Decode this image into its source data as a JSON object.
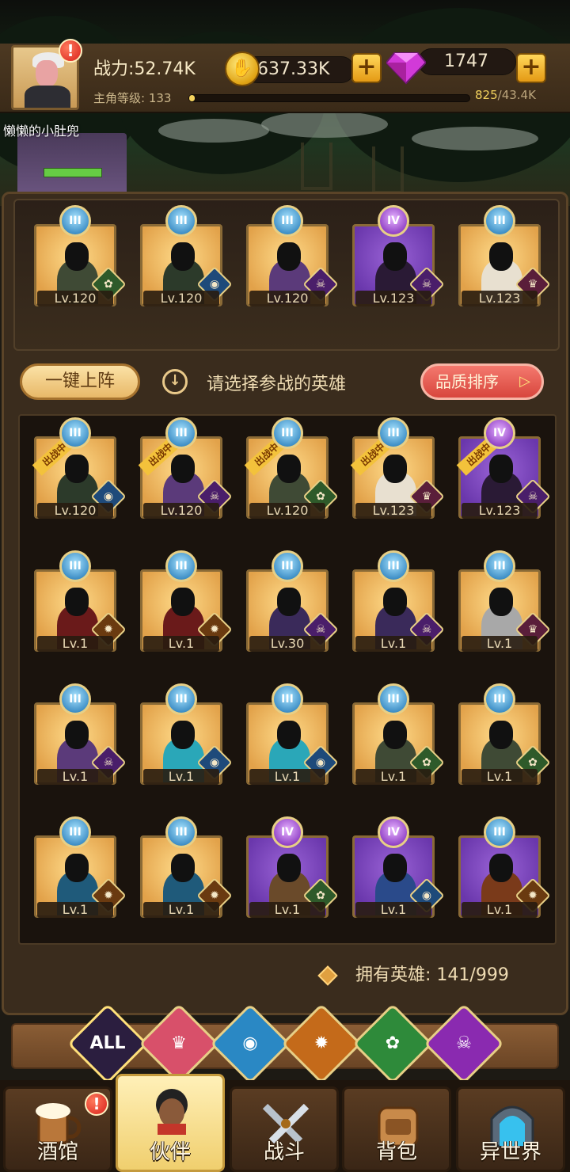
{
  "header": {
    "power_label": "战力:52.74K",
    "gold": "637.33K",
    "gems": "1747",
    "level_label": "主角等级:",
    "level": "133",
    "xp_current": "825",
    "xp_max": "/43.4K",
    "xp_progress": 0.019,
    "player_name": "懒懒的小肚兜",
    "alert_symbol": "!",
    "plus_symbol": "+"
  },
  "team": [
    {
      "rank": "III",
      "level": "Lv.120",
      "bg": "gold",
      "skin": "#3f4a35",
      "type": "elf"
    },
    {
      "rank": "III",
      "level": "Lv.120",
      "bg": "gold",
      "skin": "#2c3a2a",
      "type": "fish"
    },
    {
      "rank": "III",
      "level": "Lv.120",
      "bg": "gold",
      "skin": "#5b3a7a",
      "type": "demon"
    },
    {
      "rank": "IV",
      "level": "Lv.123",
      "bg": "purple",
      "skin": "#2a1a35",
      "type": "demon"
    },
    {
      "rank": "III",
      "level": "Lv.123",
      "bg": "gold",
      "skin": "#e8e0d0",
      "type": "knight"
    }
  ],
  "actions": {
    "oneclick_label": "一键上阵",
    "hint": "请选择参战的英雄",
    "sort_label": "品质排序",
    "down_symbol": "↓",
    "sort_arrow": "▷"
  },
  "deployed_ribbon": "出战中",
  "heroes": [
    {
      "rank": "III",
      "level": "Lv.120",
      "bg": "gold",
      "skin": "#2c3a2a",
      "type": "fish",
      "deployed": true
    },
    {
      "rank": "III",
      "level": "Lv.120",
      "bg": "gold",
      "skin": "#5b3a7a",
      "type": "demon",
      "deployed": true
    },
    {
      "rank": "III",
      "level": "Lv.120",
      "bg": "gold",
      "skin": "#3f4a35",
      "type": "elf",
      "deployed": true
    },
    {
      "rank": "III",
      "level": "Lv.123",
      "bg": "gold",
      "skin": "#e8e0d0",
      "type": "knight",
      "deployed": true
    },
    {
      "rank": "IV",
      "level": "Lv.123",
      "bg": "purple",
      "skin": "#2a1a35",
      "type": "demon",
      "deployed": true
    },
    {
      "rank": "III",
      "level": "Lv.1",
      "bg": "gold",
      "skin": "#6a1a1a",
      "type": "beast",
      "deployed": false
    },
    {
      "rank": "III",
      "level": "Lv.1",
      "bg": "gold",
      "skin": "#6a1a1a",
      "type": "beast",
      "deployed": false
    },
    {
      "rank": "III",
      "level": "Lv.30",
      "bg": "gold",
      "skin": "#3a2a5a",
      "type": "demon",
      "deployed": false
    },
    {
      "rank": "III",
      "level": "Lv.1",
      "bg": "gold",
      "skin": "#3a2a5a",
      "type": "demon",
      "deployed": false
    },
    {
      "rank": "III",
      "level": "Lv.1",
      "bg": "gold",
      "skin": "#a8a8a8",
      "type": "knight",
      "deployed": false
    },
    {
      "rank": "III",
      "level": "Lv.1",
      "bg": "gold",
      "skin": "#5b3a7a",
      "type": "demon",
      "deployed": false
    },
    {
      "rank": "III",
      "level": "Lv.1",
      "bg": "gold",
      "skin": "#2aa7b8",
      "type": "fish",
      "deployed": false
    },
    {
      "rank": "III",
      "level": "Lv.1",
      "bg": "gold",
      "skin": "#2aa7b8",
      "type": "fish",
      "deployed": false
    },
    {
      "rank": "III",
      "level": "Lv.1",
      "bg": "gold",
      "skin": "#3f4a35",
      "type": "elf",
      "deployed": false
    },
    {
      "rank": "III",
      "level": "Lv.1",
      "bg": "gold",
      "skin": "#3f4a35",
      "type": "elf",
      "deployed": false
    },
    {
      "rank": "III",
      "level": "Lv.1",
      "bg": "gold",
      "skin": "#1f5a7a",
      "type": "beast",
      "deployed": false
    },
    {
      "rank": "III",
      "level": "Lv.1",
      "bg": "gold",
      "skin": "#1f5a7a",
      "type": "beast",
      "deployed": false
    },
    {
      "rank": "IV",
      "level": "Lv.1",
      "bg": "purple",
      "skin": "#6a4a2a",
      "type": "elf",
      "deployed": false
    },
    {
      "rank": "IV",
      "level": "Lv.1",
      "bg": "purple",
      "skin": "#2a4a8a",
      "type": "fish",
      "deployed": false
    },
    {
      "rank": "III",
      "level": "Lv.1",
      "bg": "purple",
      "skin": "#7a3a1a",
      "type": "beast",
      "deployed": false
    }
  ],
  "owned": {
    "label": "拥有英雄:",
    "count": "141/999"
  },
  "filters": [
    {
      "name": "all",
      "label": "ALL",
      "color": "#2b1e3f",
      "glyph": ""
    },
    {
      "name": "knight",
      "label": "",
      "color": "#d8506a",
      "glyph": "♛"
    },
    {
      "name": "fish",
      "label": "",
      "color": "#2a88c4",
      "glyph": "◉"
    },
    {
      "name": "beast",
      "label": "",
      "color": "#c46a1a",
      "glyph": "✹"
    },
    {
      "name": "elf",
      "label": "",
      "color": "#2e8a3a",
      "glyph": "✿"
    },
    {
      "name": "demon",
      "label": "",
      "color": "#8a2ab0",
      "glyph": "☠"
    }
  ],
  "type_glyphs": {
    "elf": "✿",
    "fish": "◉",
    "demon": "☠",
    "knight": "♛",
    "beast": "✹"
  },
  "type_colors": {
    "elf": "#2e5a2a",
    "fish": "#1e4a7a",
    "demon": "#4a1e6a",
    "knight": "#5a1e3a",
    "beast": "#6a3a10"
  },
  "nav": [
    {
      "name": "tavern",
      "label": "酒馆",
      "active": false,
      "alert": true
    },
    {
      "name": "partner",
      "label": "伙伴",
      "active": true,
      "alert": false
    },
    {
      "name": "battle",
      "label": "战斗",
      "active": false,
      "alert": false
    },
    {
      "name": "backpack",
      "label": "背包",
      "active": false,
      "alert": false
    },
    {
      "name": "otherworld",
      "label": "异世界",
      "active": false,
      "alert": false
    }
  ]
}
